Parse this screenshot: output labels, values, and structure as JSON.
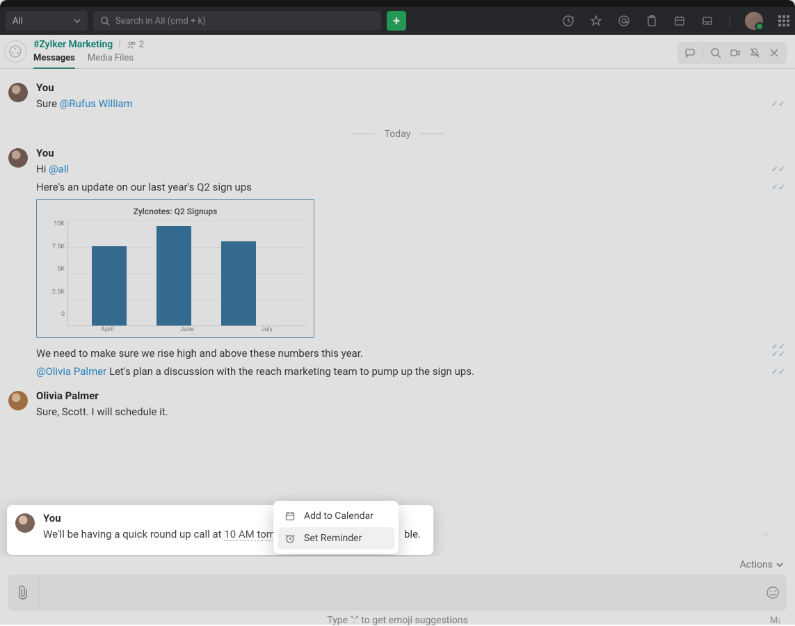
{
  "topbar": {
    "scope": "All",
    "search_placeholder": "Search in All (cmd + k)"
  },
  "channel": {
    "name": "#Zylker Marketing",
    "member_count": "2",
    "tabs": {
      "messages": "Messages",
      "media": "Media Files"
    }
  },
  "divider": {
    "today": "Today"
  },
  "messages": {
    "m0": {
      "author": "You",
      "text_prefix": "Sure ",
      "mention": "@Rufus William"
    },
    "m1": {
      "author": "You",
      "text_prefix": "Hi ",
      "mention": "@all",
      "l2": "Here's an update on our last year's Q2 sign ups",
      "l4": "We need to make sure we rise high and above these numbers this year.",
      "l5_mention": "@Olivia Palmer",
      "l5_rest": " Let's plan a discussion with the reach marketing team to pump up the sign ups."
    },
    "m2": {
      "author": "Olivia Palmer",
      "text": "Sure, Scott. I will schedule it."
    },
    "m3": {
      "author": "You",
      "pre": "We'll be having a quick round up call at ",
      "chip": "10 AM tomo.",
      "post": "ble."
    }
  },
  "chart_data": {
    "type": "bar",
    "title": "Zylcnotes: Q2 Signups",
    "categories": [
      "April",
      "June",
      "July"
    ],
    "values": [
      7600,
      9500,
      8000
    ],
    "y_ticks": [
      "10K",
      "7.5K",
      "5K",
      "2.5K",
      "0"
    ],
    "ylim": [
      0,
      10000
    ]
  },
  "popup": {
    "add_calendar": "Add to Calendar",
    "set_reminder": "Set Reminder"
  },
  "footer": {
    "actions": "Actions",
    "hint": "Type \":\" to get emoji suggestions",
    "md": "M↓"
  }
}
